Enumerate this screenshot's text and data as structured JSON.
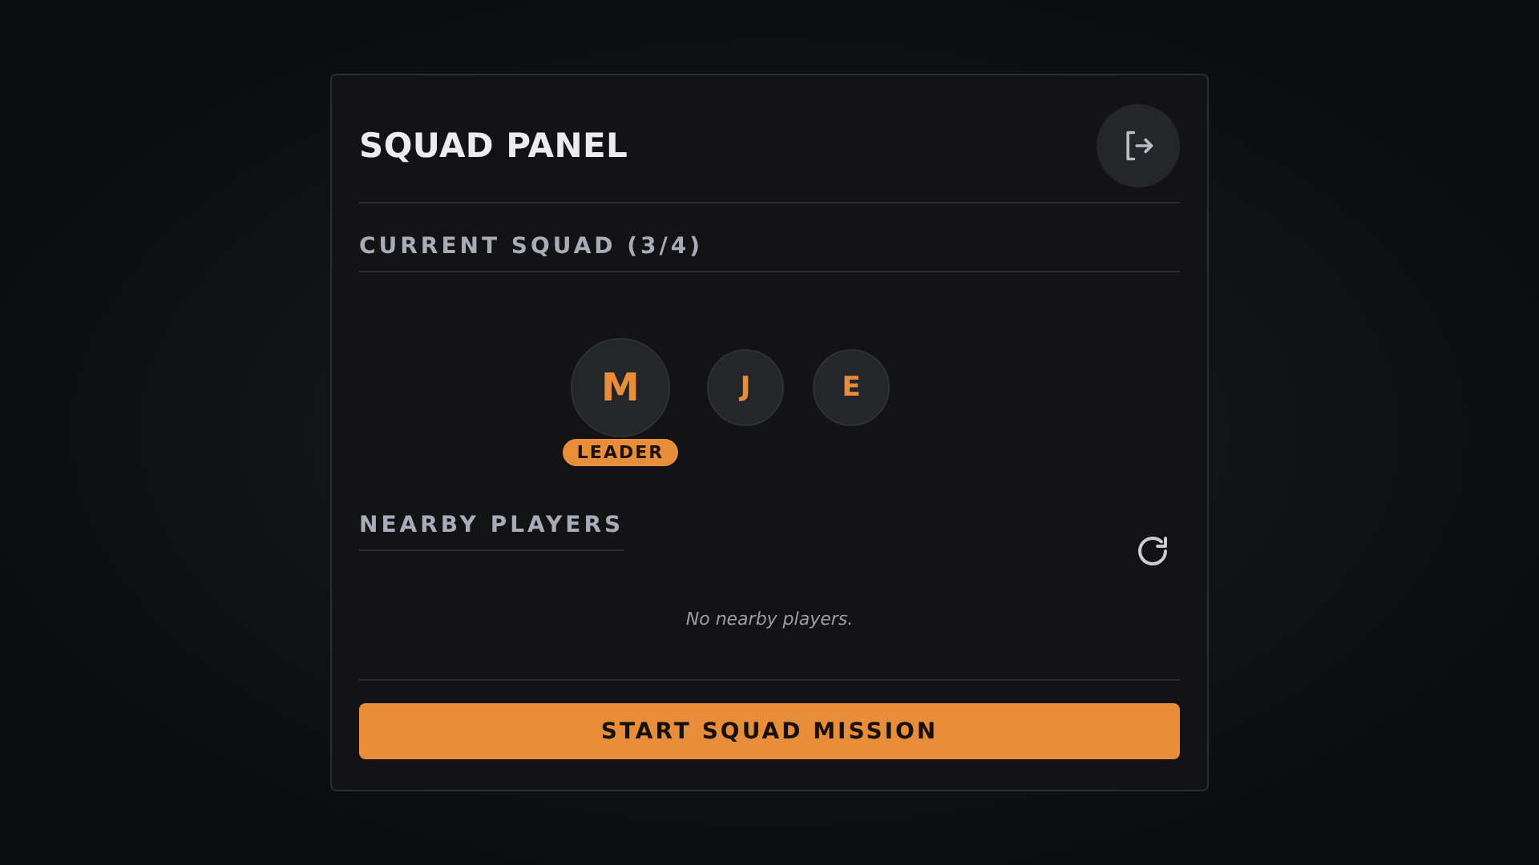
{
  "panel": {
    "title": "SQUAD PANEL"
  },
  "current_squad": {
    "heading": "CURRENT SQUAD (3/4)",
    "members": [
      {
        "initial": "M",
        "leader": true,
        "badge": "LEADER"
      },
      {
        "initial": "J",
        "leader": false
      },
      {
        "initial": "E",
        "leader": false
      }
    ]
  },
  "nearby_players": {
    "heading": "NEARBY PLAYERS",
    "empty_message": "No nearby players."
  },
  "start_button": {
    "label": "START SQUAD MISSION"
  }
}
